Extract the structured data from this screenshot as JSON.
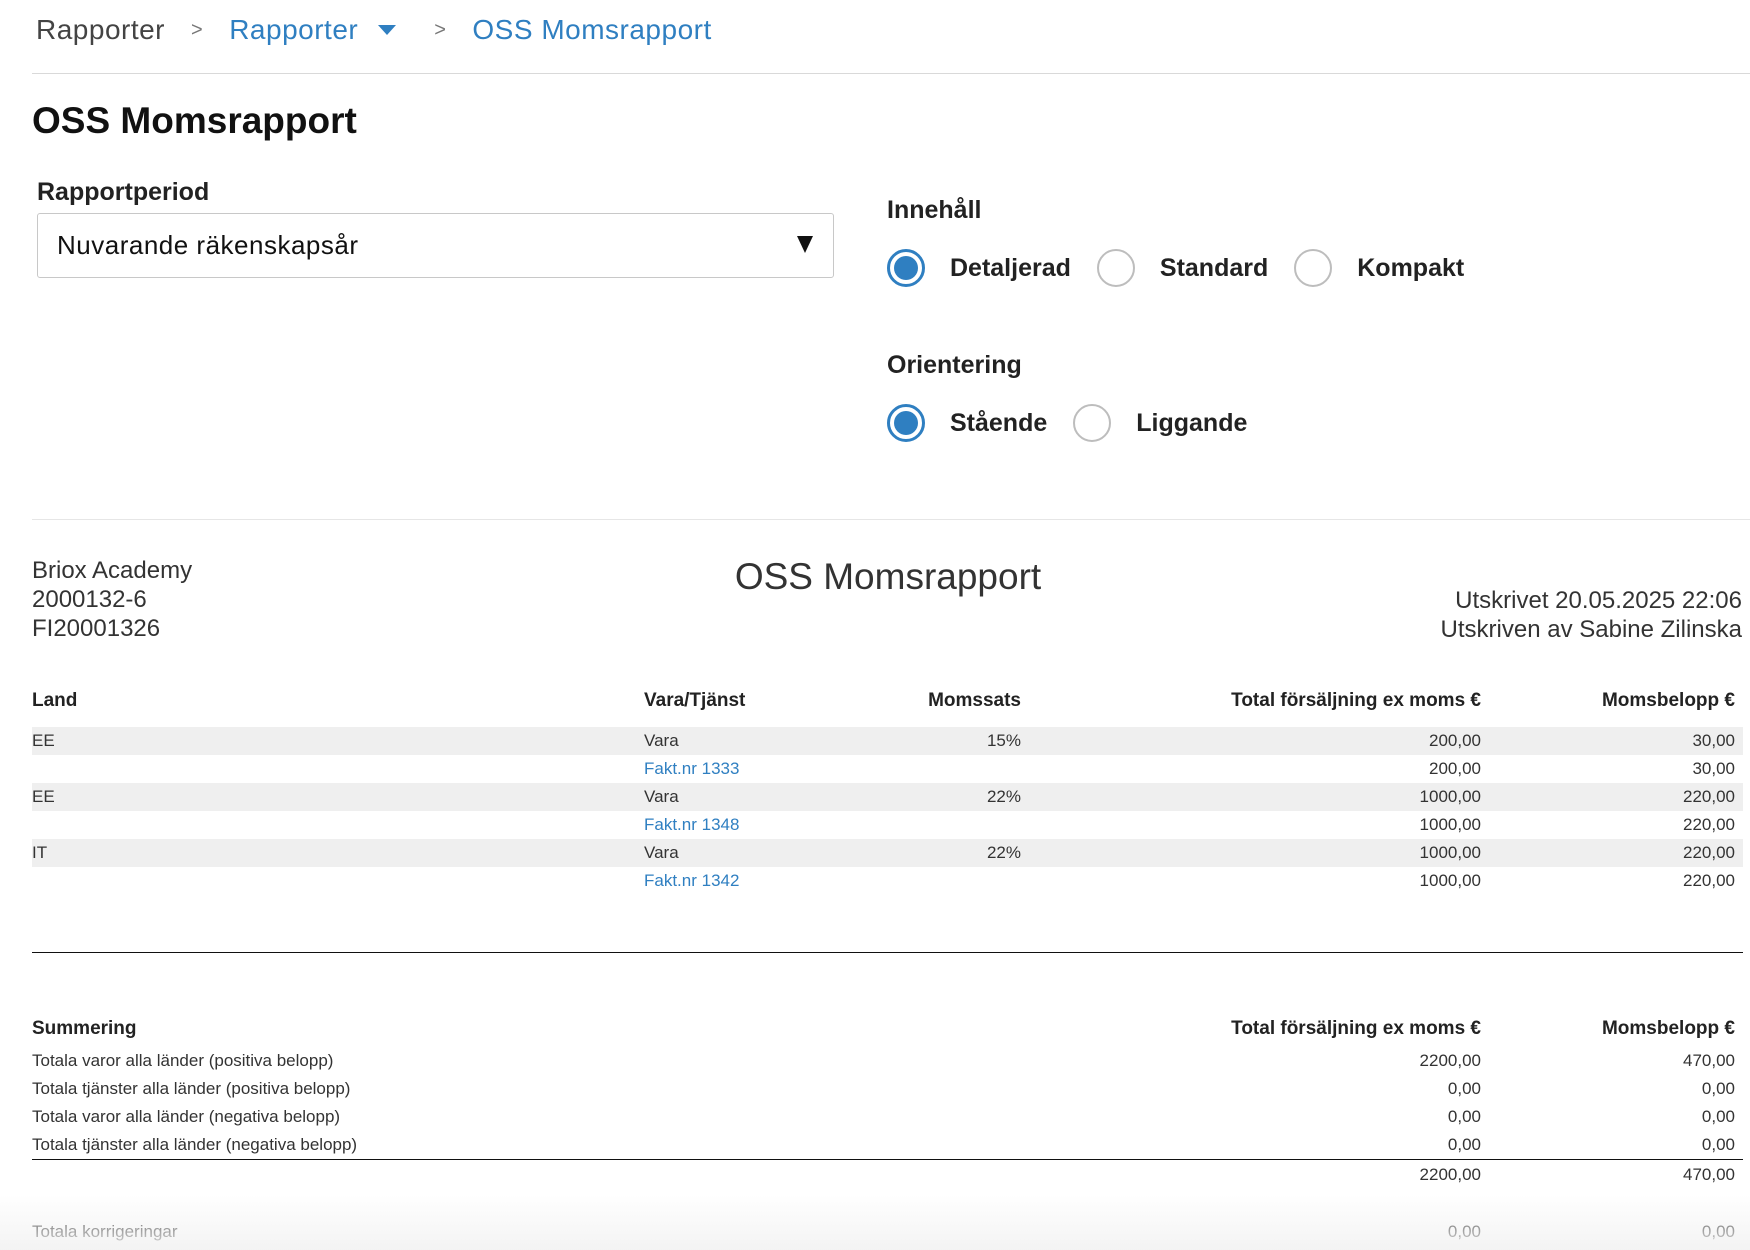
{
  "breadcrumb": {
    "root": "Rapporter",
    "section": "Rapporter",
    "current": "OSS Momsrapport"
  },
  "page_title": "OSS Momsrapport",
  "filters": {
    "period_label": "Rapportperiod",
    "period_value": "Nuvarande räkenskapsår",
    "content_label": "Innehåll",
    "content_options": [
      "Detaljerad",
      "Standard",
      "Kompakt"
    ],
    "content_selected": "Detaljerad",
    "orientation_label": "Orientering",
    "orientation_options": [
      "Stående",
      "Liggande"
    ],
    "orientation_selected": "Stående"
  },
  "report": {
    "company_name": "Briox Academy",
    "org_number": "2000132-6",
    "vat_number": "FI20001326",
    "title": "OSS Momsrapport",
    "printed_at": "Utskrivet 20.05.2025 22:06",
    "printed_by": "Utskriven av Sabine Zilinska"
  },
  "table": {
    "headers": {
      "land": "Land",
      "vara": "Vara/Tjänst",
      "momssats": "Momssats",
      "total": "Total försäljning ex moms €",
      "belopp": "Momsbelopp €"
    },
    "rows": [
      {
        "land": "EE",
        "vara": "Vara",
        "momssats": "15%",
        "total": "200,00",
        "belopp": "30,00"
      },
      {
        "land": "",
        "vara": "Fakt.nr 1333",
        "momssats": "",
        "total": "200,00",
        "belopp": "30,00"
      },
      {
        "land": "EE",
        "vara": "Vara",
        "momssats": "22%",
        "total": "1000,00",
        "belopp": "220,00"
      },
      {
        "land": "",
        "vara": "Fakt.nr 1348",
        "momssats": "",
        "total": "1000,00",
        "belopp": "220,00"
      },
      {
        "land": "IT",
        "vara": "Vara",
        "momssats": "22%",
        "total": "1000,00",
        "belopp": "220,00"
      },
      {
        "land": "",
        "vara": "Fakt.nr 1342",
        "momssats": "",
        "total": "1000,00",
        "belopp": "220,00"
      }
    ]
  },
  "summary": {
    "headers": {
      "label": "Summering",
      "total": "Total försäljning ex moms €",
      "belopp": "Momsbelopp €"
    },
    "rows": [
      {
        "label": "Totala varor alla länder (positiva belopp)",
        "total": "2200,00",
        "belopp": "470,00"
      },
      {
        "label": "Totala tjänster alla länder (positiva belopp)",
        "total": "0,00",
        "belopp": "0,00"
      },
      {
        "label": "Totala varor alla länder (negativa belopp)",
        "total": "0,00",
        "belopp": "0,00"
      },
      {
        "label": "Totala tjänster alla länder (negativa belopp)",
        "total": "0,00",
        "belopp": "0,00"
      }
    ],
    "sum": {
      "total": "2200,00",
      "belopp": "470,00"
    },
    "corrections": {
      "label": "Totala korrigeringar",
      "total": "0,00",
      "belopp": "0,00"
    }
  }
}
